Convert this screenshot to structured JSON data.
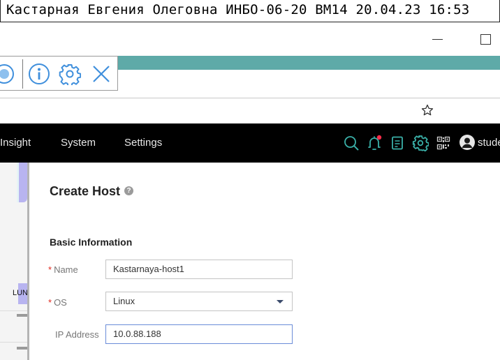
{
  "caption": {
    "text": "Кастарная Евгения Олеговна ИНБО-06-20 ВМ14 20.04.23 16:53"
  },
  "window": {
    "minimize_icon": "minimize-icon",
    "maximize_icon": "maximize-icon"
  },
  "toolbar": {
    "icons": [
      "record-icon",
      "info-icon",
      "gear-icon",
      "close-icon"
    ],
    "accent_color": "#3f8fdc"
  },
  "browser": {
    "bookmark_icon": "star-icon",
    "band_color": "#5eaaa8"
  },
  "topnav": {
    "items": [
      {
        "label": "Insight"
      },
      {
        "label": "System"
      },
      {
        "label": "Settings"
      }
    ],
    "icons": [
      "search-icon",
      "bell-icon",
      "document-icon",
      "gear-icon",
      "qr-code-icon",
      "avatar-icon"
    ],
    "user": "stude",
    "icon_color": "#3ab0a8",
    "notification_dot_color": "#ff2d4a"
  },
  "sidebar": {
    "lun_label": "LUN"
  },
  "form": {
    "title": "Create Host",
    "help_glyph": "?",
    "section": "Basic Information",
    "required_mark": "*",
    "fields": {
      "name": {
        "label": "Name",
        "value": "Kastarnaya-host1"
      },
      "os": {
        "label": "OS",
        "value": "Linux"
      },
      "ip": {
        "label": "IP Address",
        "value": "10.0.88.188"
      }
    }
  }
}
